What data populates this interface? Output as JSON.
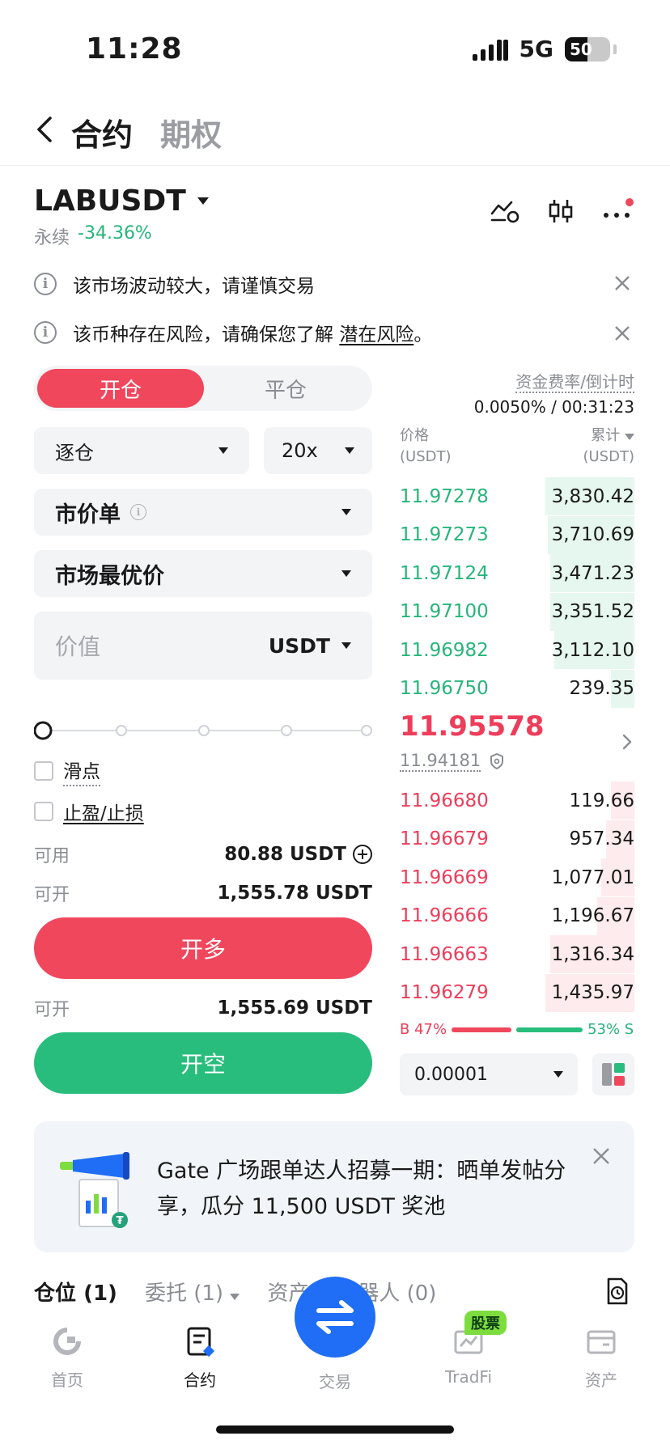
{
  "status_bar": {
    "time": "11:28",
    "network": "5G",
    "battery": "50"
  },
  "header": {
    "tab_futures": "合约",
    "tab_options": "期权"
  },
  "symbol": {
    "name": "LABUSDT",
    "type": "永续",
    "change": "-34.36%"
  },
  "notices": [
    {
      "text": "该市场波动较大，请谨慎交易"
    },
    {
      "text": "该币种存在风险，请确保您了解 ",
      "link": "潜在风险",
      "suffix": "。"
    }
  ],
  "trade": {
    "open_tab": "开仓",
    "close_tab": "平仓",
    "margin_mode": "逐仓",
    "leverage": "20x",
    "order_type": "市价单",
    "price_type": "市场最优价",
    "value_placeholder": "价值",
    "value_unit": "USDT",
    "slippage_label": "滑点",
    "tpsl_label": "止盈/止损",
    "available_label": "可用",
    "available_value": "80.88 USDT",
    "max_long_label": "可开",
    "max_long_value": "1,555.78 USDT",
    "long_button": "开多",
    "max_short_label": "可开",
    "max_short_value": "1,555.69 USDT",
    "short_button": "开空"
  },
  "funding": {
    "label": "资金费率/倒计时",
    "value": "0.0050% / 00:31:23"
  },
  "orderbook": {
    "price_header": "价格",
    "price_unit": "(USDT)",
    "total_header": "累计",
    "total_unit": "(USDT)",
    "upper_rows": [
      {
        "price": "11.97278",
        "total": "3,830.42",
        "depth": 0.38
      },
      {
        "price": "11.97273",
        "total": "3,710.69",
        "depth": 0.37
      },
      {
        "price": "11.97124",
        "total": "3,471.23",
        "depth": 0.36
      },
      {
        "price": "11.97100",
        "total": "3,351.52",
        "depth": 0.36
      },
      {
        "price": "11.96982",
        "total": "3,112.10",
        "depth": 0.34
      },
      {
        "price": "11.96750",
        "total": "239.35",
        "depth": 0.1
      }
    ],
    "last_price": "11.95578",
    "mark_price": "11.94181",
    "lower_rows": [
      {
        "price": "11.96680",
        "total": "119.66",
        "depth": 0.1
      },
      {
        "price": "11.96679",
        "total": "957.34",
        "depth": 0.12
      },
      {
        "price": "11.96669",
        "total": "1,077.01",
        "depth": 0.14
      },
      {
        "price": "11.96666",
        "total": "1,196.67",
        "depth": 0.16
      },
      {
        "price": "11.96663",
        "total": "1,316.34",
        "depth": 0.36
      },
      {
        "price": "11.96279",
        "total": "1,435.97",
        "depth": 0.38
      }
    ],
    "buy_ratio": "B 47%",
    "sell_ratio": "53% S",
    "precision": "0.00001"
  },
  "banner": {
    "text": "Gate 广场跟单达人招募一期：晒单发帖分享，瓜分 11,500 USDT 奖池"
  },
  "position_tabs": {
    "positions": "仓位",
    "positions_count": "(1)",
    "orders": "委托",
    "orders_count": "(1)",
    "assets": "资产",
    "bots": "机器人",
    "bots_count": "(0)"
  },
  "bottom_nav": {
    "home": "首页",
    "futures": "合约",
    "trade": "交易",
    "tradfi": "TradFi",
    "assets": "资产",
    "stock_badge": "股票"
  }
}
